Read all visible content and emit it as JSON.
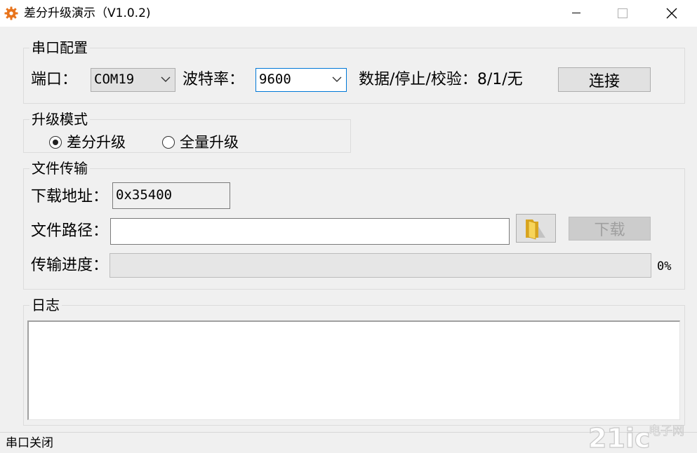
{
  "window": {
    "title": "差分升级演示（V1.0.2)",
    "app_icon": "gear-icon",
    "icon_color": "#e8741c"
  },
  "serial": {
    "group_title": "串口配置",
    "port_label": "端口：",
    "port_value": "COM19",
    "baud_label": "波特率：",
    "baud_value": "9600",
    "format_text": "数据/停止/校验：8/1/无",
    "connect_label": "连接"
  },
  "mode": {
    "group_title": "升级模式",
    "options": [
      {
        "label": "差分升级",
        "checked": true
      },
      {
        "label": "全量升级",
        "checked": false
      }
    ]
  },
  "transfer": {
    "group_title": "文件传输",
    "address_label": "下载地址：",
    "address_value": "0x35400",
    "path_label": "文件路径：",
    "path_value": "",
    "browse_icon": "folder-icon",
    "download_label": "下载",
    "progress_label": "传输进度：",
    "progress_value": 0,
    "progress_text": "0%"
  },
  "log": {
    "group_title": "日志",
    "content": ""
  },
  "status": {
    "text": "串口关闭"
  },
  "watermark": {
    "text": "21ic 电子网"
  }
}
